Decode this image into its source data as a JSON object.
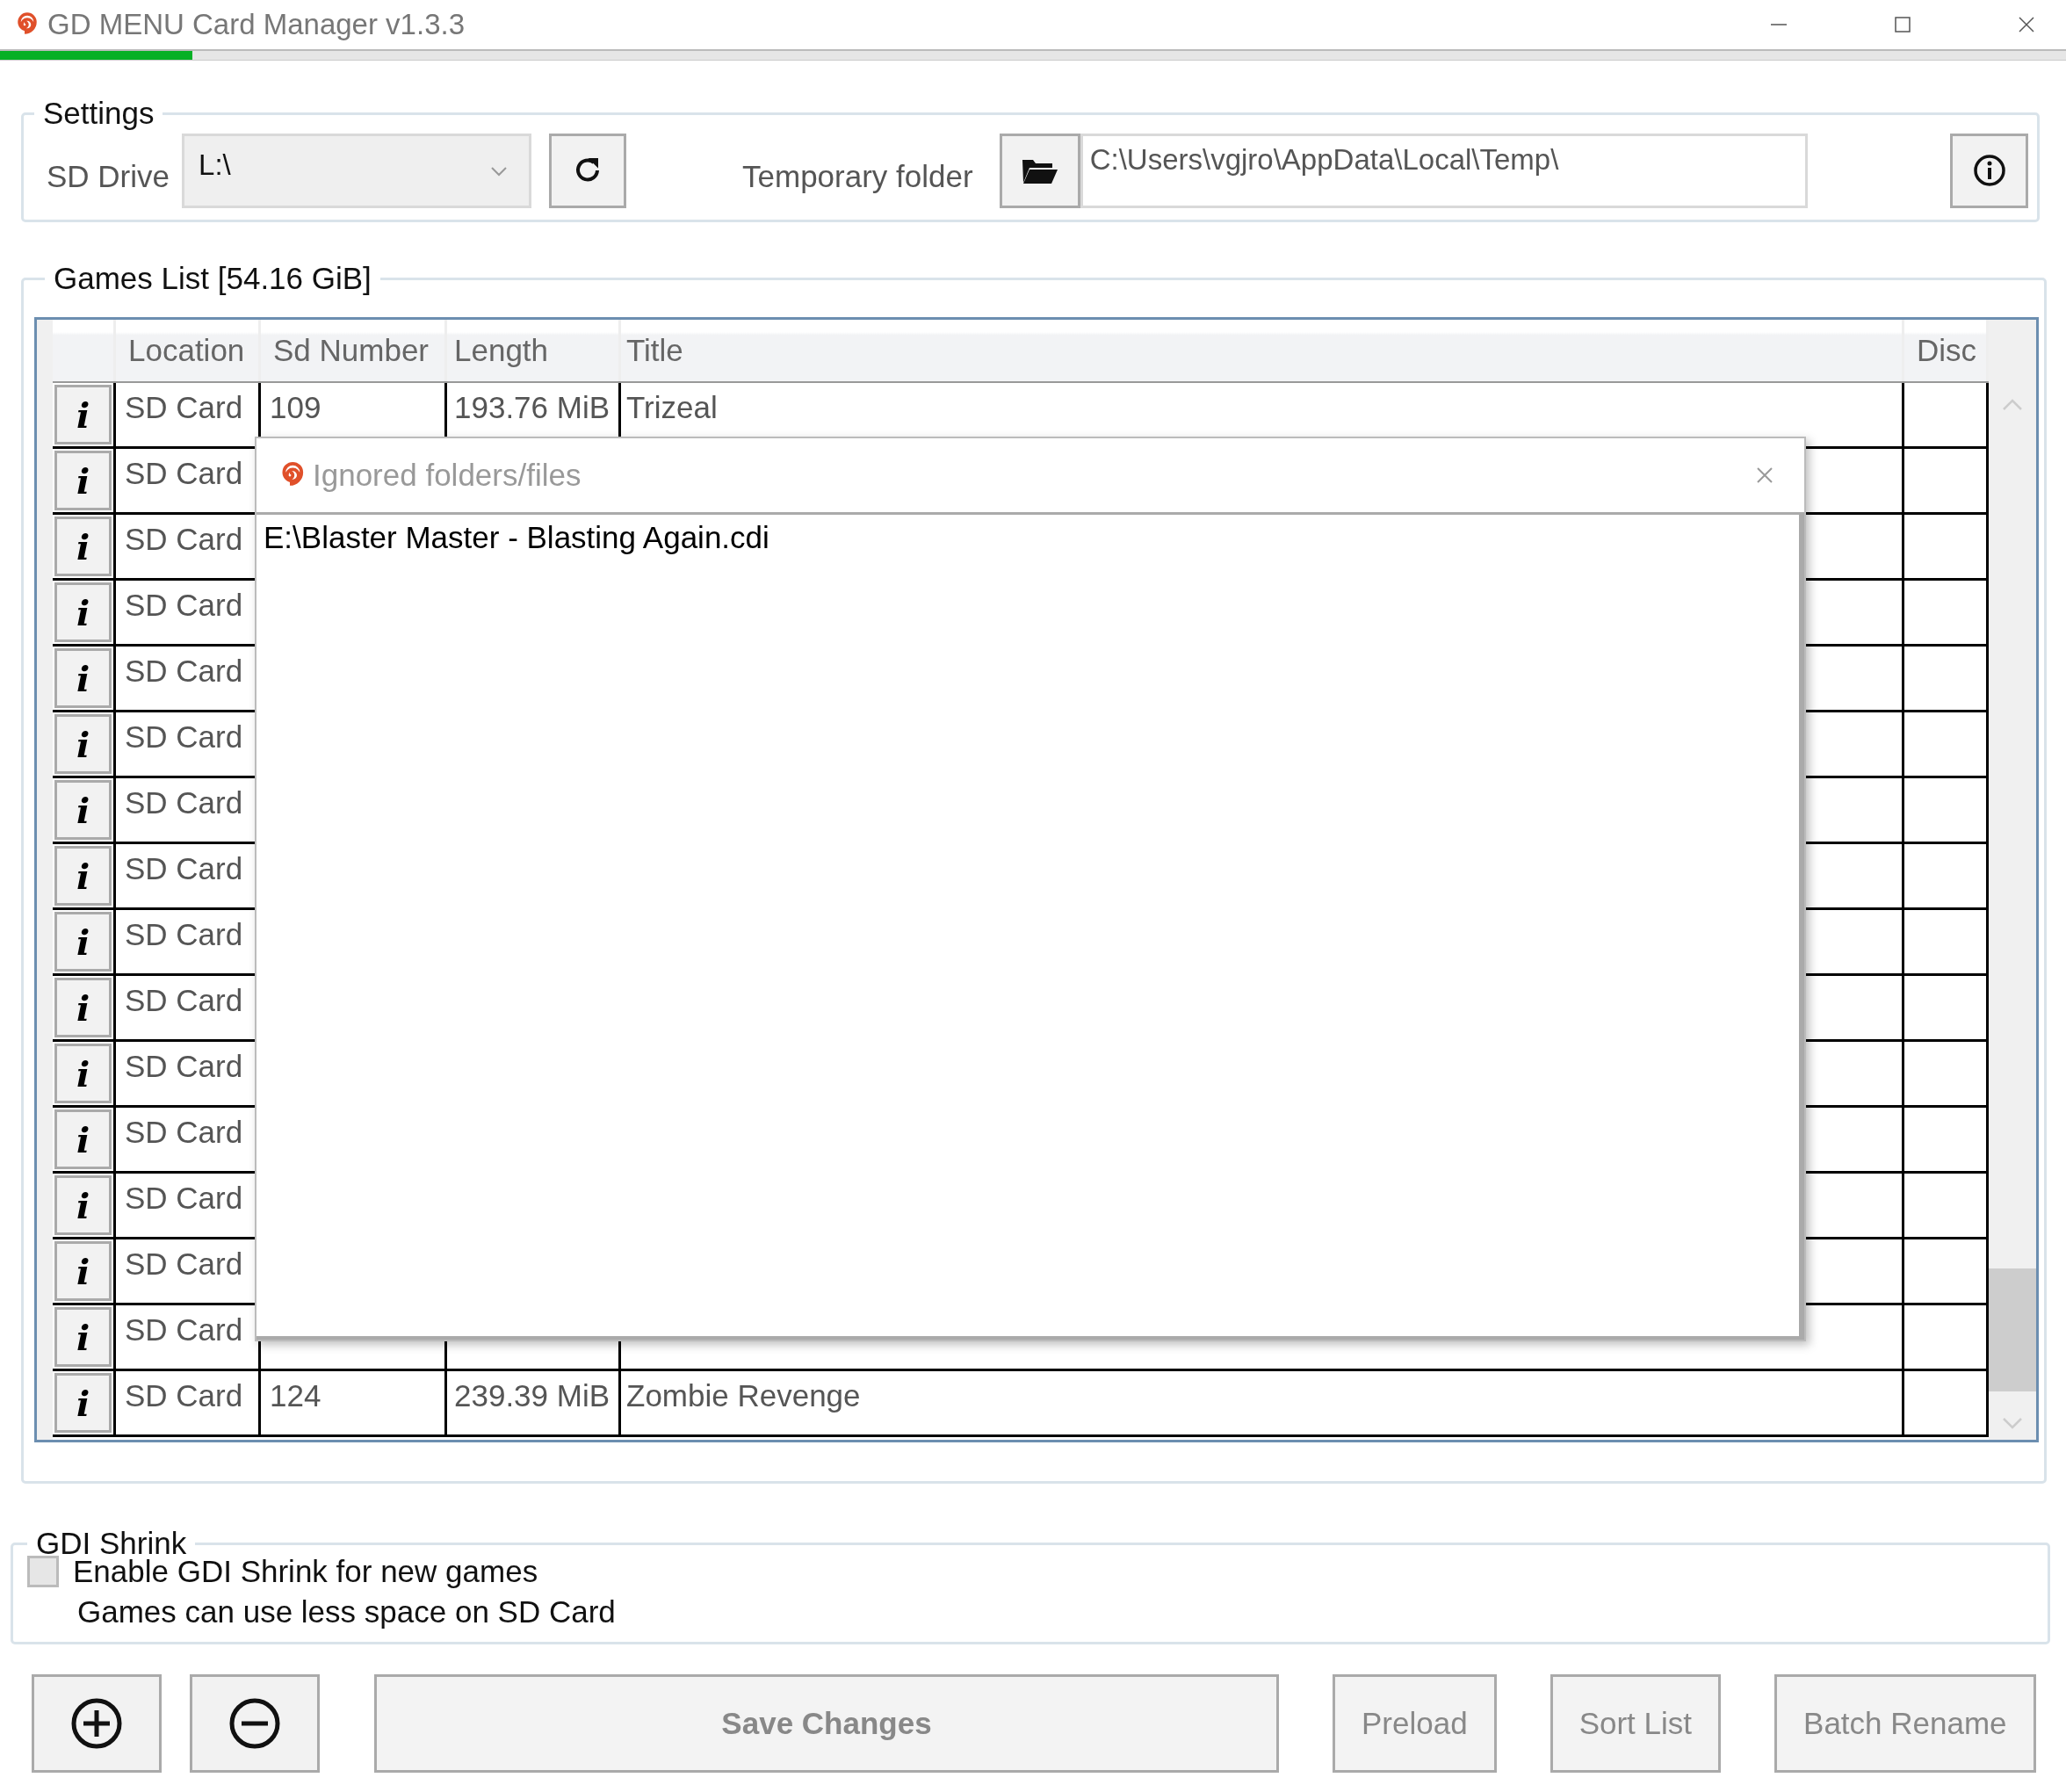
{
  "window": {
    "title": "GD MENU Card Manager v1.3.3"
  },
  "progress": {
    "level": 0.093
  },
  "settings": {
    "legend": "Settings",
    "sd_drive_label": "SD Drive",
    "sd_drive_value": "L:\\",
    "temp_folder_label": "Temporary folder",
    "temp_folder_value": "C:\\Users\\vgjro\\AppData\\Local\\Temp\\"
  },
  "games_list": {
    "legend": "Games List [54.16 GiB]",
    "columns": [
      "Location",
      "Sd Number",
      "Length",
      "Title",
      "Disc"
    ],
    "rows": [
      {
        "button": "i",
        "location": "SD Card",
        "sd_number": "109",
        "length": "193.76 MiB",
        "title": "Trizeal"
      },
      {
        "button": "i",
        "location": "SD Card"
      },
      {
        "button": "i",
        "location": "SD Card"
      },
      {
        "button": "i",
        "location": "SD Card"
      },
      {
        "button": "i",
        "location": "SD Card"
      },
      {
        "button": "i",
        "location": "SD Card"
      },
      {
        "button": "i",
        "location": "SD Card"
      },
      {
        "button": "i",
        "location": "SD Card"
      },
      {
        "button": "i",
        "location": "SD Card"
      },
      {
        "button": "i",
        "location": "SD Card"
      },
      {
        "button": "i",
        "location": "SD Card"
      },
      {
        "button": "i",
        "location": "SD Card"
      },
      {
        "button": "i",
        "location": "SD Card"
      },
      {
        "button": "i",
        "location": "SD Card"
      },
      {
        "button": "i",
        "location": "SD Card"
      },
      {
        "button": "i",
        "location": "SD Card",
        "sd_number": "124",
        "length": "239.39 MiB",
        "title": "Zombie Revenge"
      }
    ]
  },
  "dialog": {
    "title": "Ignored folders/files",
    "entries": [
      "E:\\Blaster Master - Blasting Again.cdi"
    ]
  },
  "gdi_shrink": {
    "legend": "GDI Shrink",
    "checkbox_label": "Enable GDI Shrink for new games",
    "checked": false,
    "note": "Games can use less space on SD Card"
  },
  "buttons": [
    {
      "label": "Save Changes",
      "disabled": true,
      "kind": "save"
    },
    {
      "label": "Preload",
      "disabled": true,
      "kind": "normal"
    },
    {
      "label": "Sort List",
      "disabled": true,
      "kind": "normal"
    },
    {
      "label": "Batch Rename",
      "disabled": true,
      "kind": "normal"
    }
  ]
}
